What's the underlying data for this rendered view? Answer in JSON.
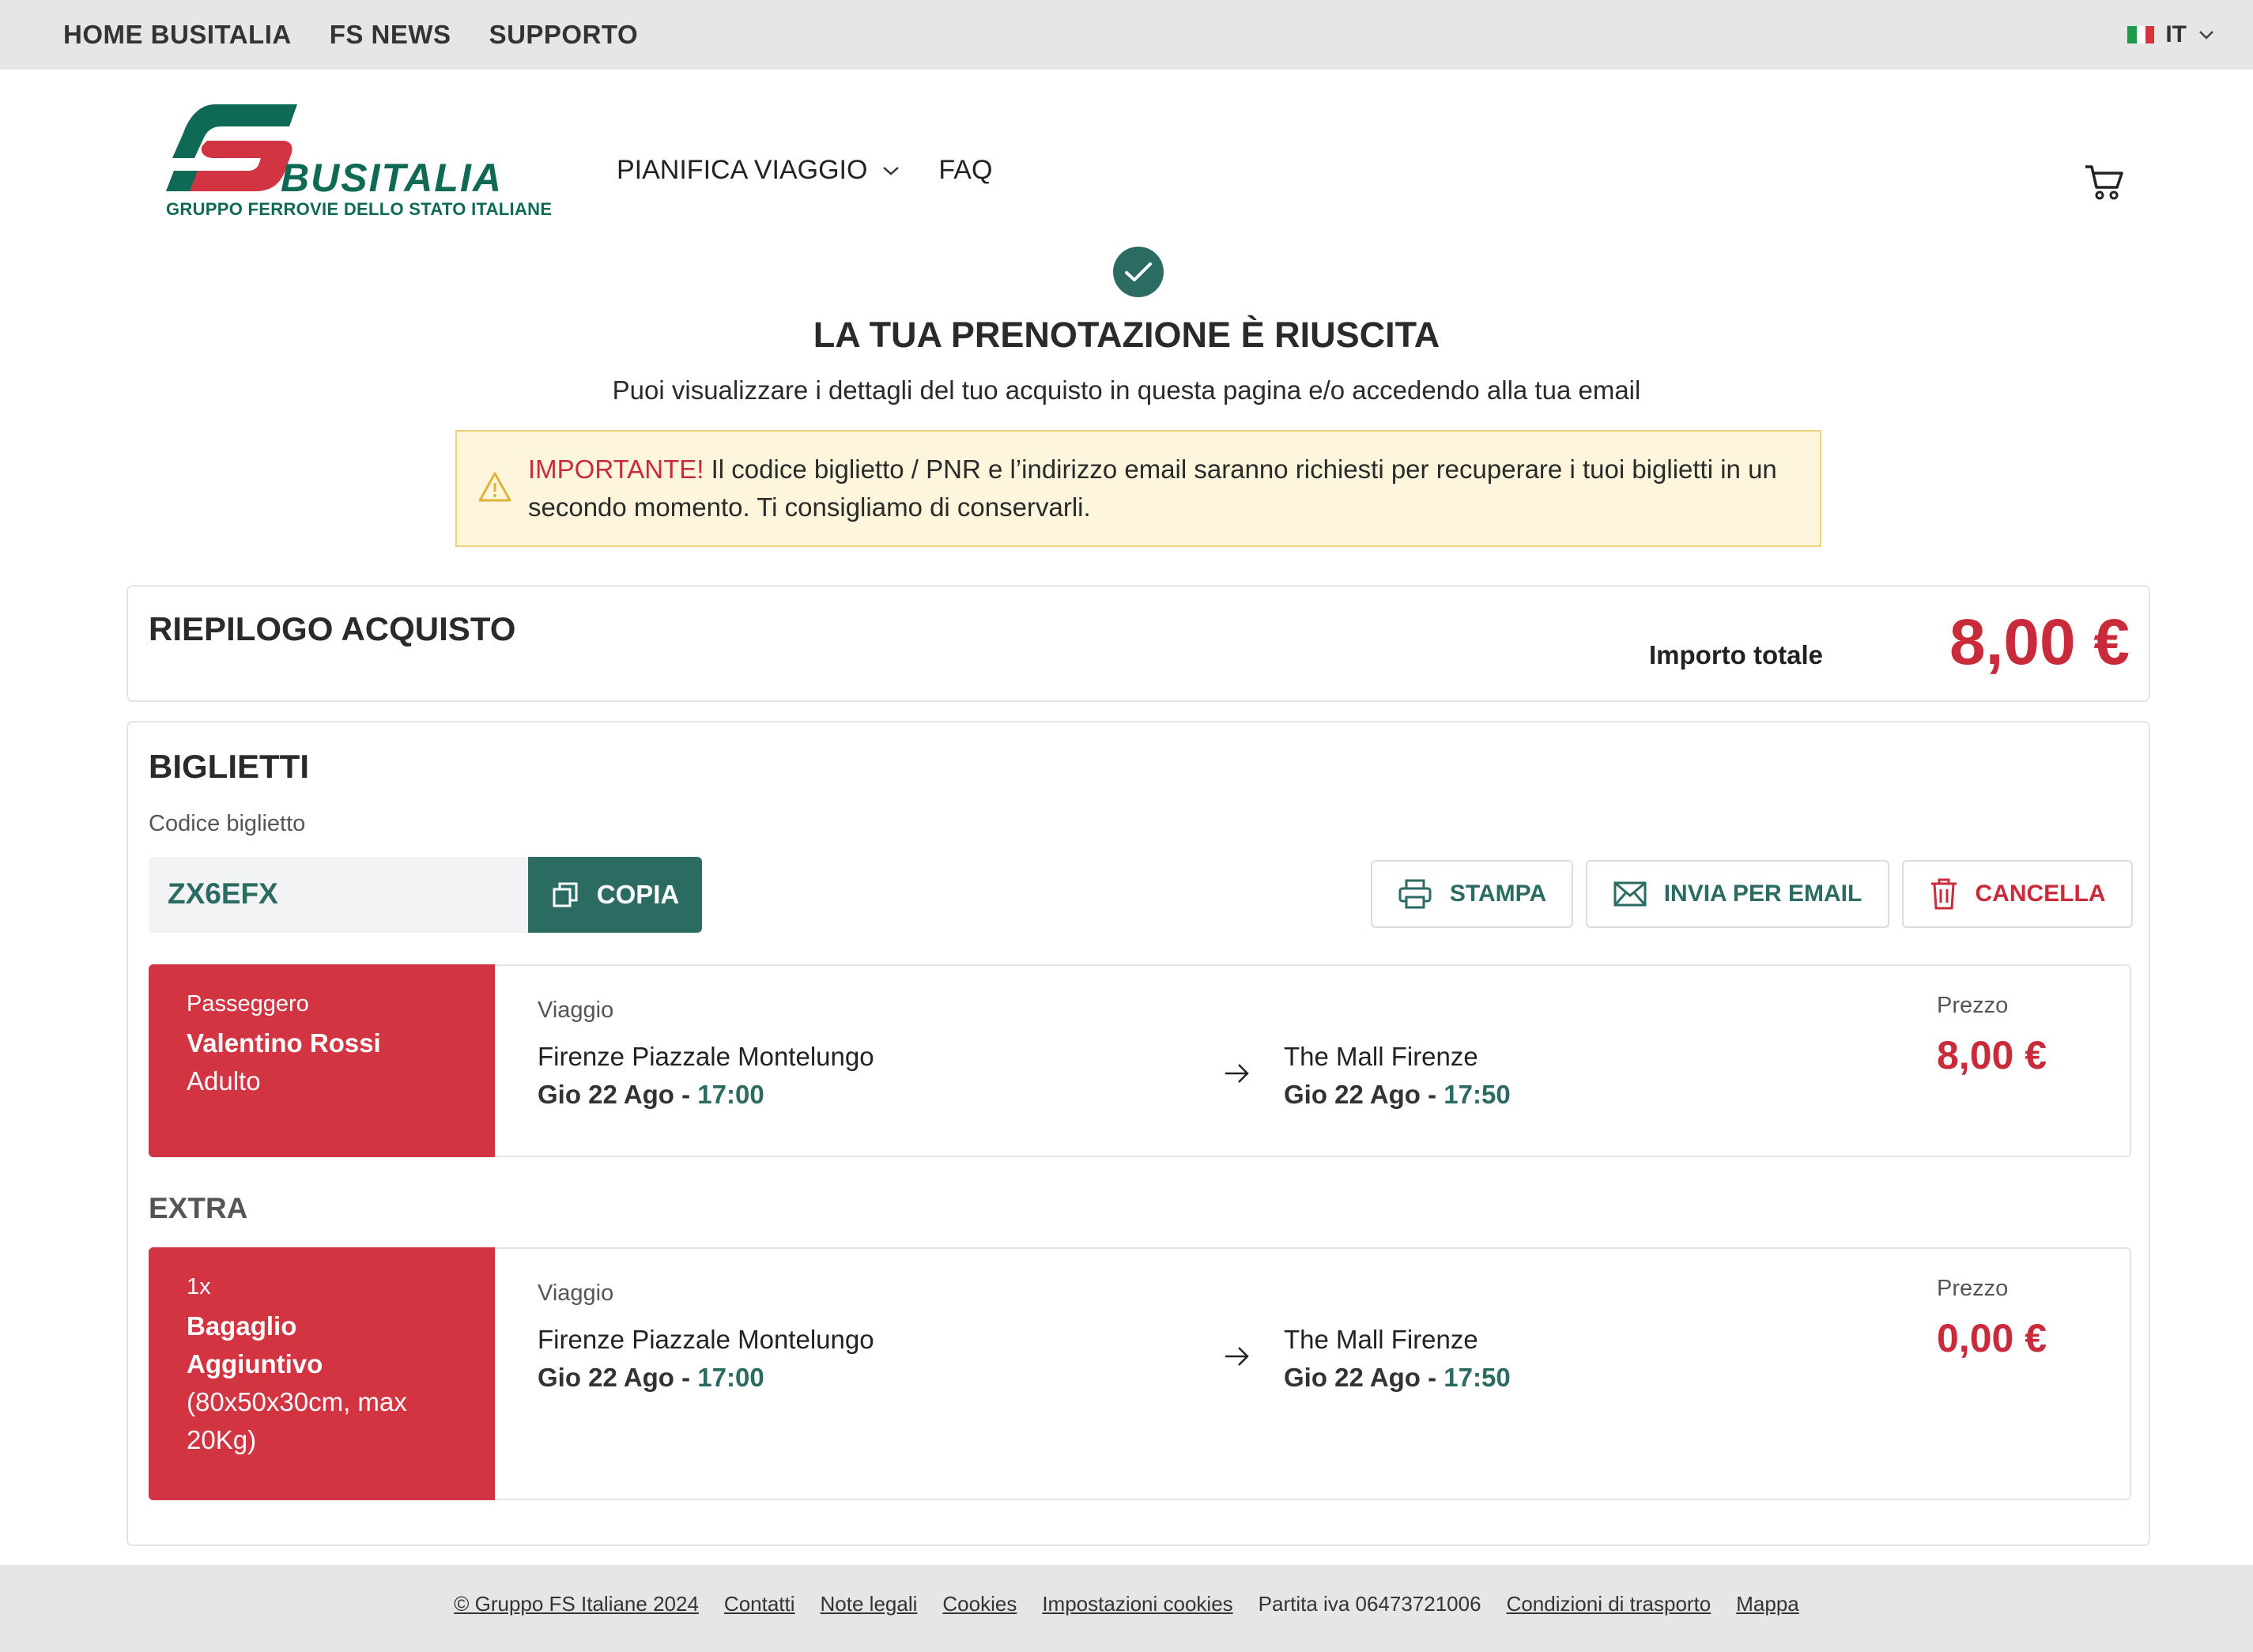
{
  "topbar": {
    "links": [
      "HOME BUSITALIA",
      "FS NEWS",
      "SUPPORTO"
    ],
    "language": "IT"
  },
  "header": {
    "logo_brand": "BUSITALIA",
    "logo_sub": "GRUPPO FERROVIE DELLO STATO ITALIANE",
    "nav": {
      "plan": "PIANIFICA VIAGGIO",
      "faq": "FAQ"
    }
  },
  "confirmation": {
    "title": "LA TUA PRENOTAZIONE È RIUSCITA",
    "subtitle": "Puoi visualizzare i dettagli del tuo acquisto in questa pagina e/o accedendo alla tua email",
    "notice_label": "IMPORTANTE!",
    "notice_text": " Il codice biglietto / PNR e l’indirizzo email saranno richiesti per recuperare i tuoi biglietti in un secondo momento. Ti consigliamo di conservarli."
  },
  "summary": {
    "title": "RIEPILOGO ACQUISTO",
    "total_label": "Importo totale",
    "total_amount": "8,00 €"
  },
  "tickets": {
    "title": "BIGLIETTI",
    "code_label": "Codice biglietto",
    "code": "ZX6EFX",
    "copy_label": "COPIA",
    "print_label": "STAMPA",
    "email_label": "INVIA PER EMAIL",
    "cancel_label": "CANCELLA",
    "passenger": {
      "label": "Passeggero",
      "name": "Valentino Rossi",
      "type": "Adulto",
      "trip_label": "Viaggio",
      "from": "Firenze Piazzale Montelungo",
      "from_date": "Gio 22 Ago - ",
      "from_time": "17:00",
      "to": "The Mall Firenze",
      "to_date": "Gio 22 Ago - ",
      "to_time": "17:50",
      "price_label": "Prezzo",
      "price": "8,00 €"
    },
    "extra_title": "EXTRA",
    "extra": {
      "qty": "1x",
      "name_line1": "Bagaglio",
      "name_line2": "Aggiuntivo",
      "desc_line1": "(80x50x30cm, max",
      "desc_line2": "20Kg)",
      "trip_label": "Viaggio",
      "from": "Firenze Piazzale Montelungo",
      "from_date": "Gio 22 Ago - ",
      "from_time": "17:00",
      "to": "The Mall Firenze",
      "to_date": "Gio 22 Ago - ",
      "to_time": "17:50",
      "price_label": "Prezzo",
      "price": "0,00 €"
    }
  },
  "footer": {
    "copyright": "© Gruppo FS Italiane 2024",
    "contatti": "Contatti",
    "note": "Note legali",
    "cookies": "Cookies",
    "cookie_settings": "Impostazioni cookies",
    "vat": "Partita iva 06473721006",
    "conditions": "Condizioni di trasporto",
    "map": "Mappa"
  },
  "colors": {
    "brand_green": "#2b6b62",
    "brand_red": "#c92b3b",
    "warning_bg": "#fdf6dc",
    "topbar_bg": "#e6e6e6"
  }
}
